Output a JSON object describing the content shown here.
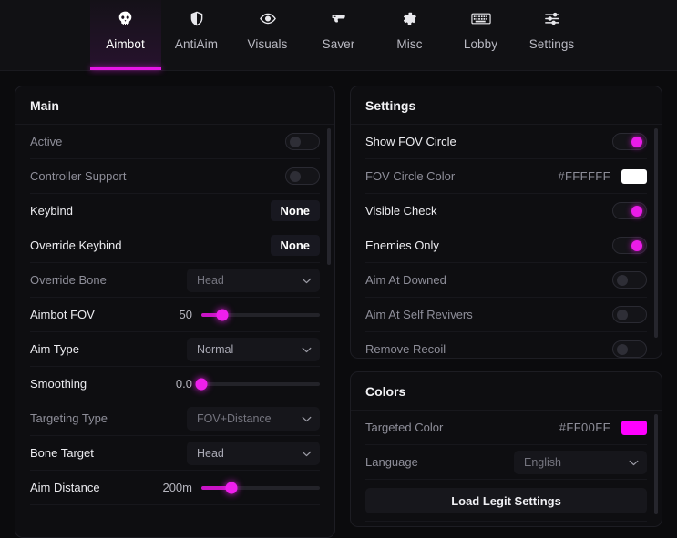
{
  "nav": {
    "tabs": [
      {
        "label": "Aimbot",
        "icon": "skull-icon",
        "active": true
      },
      {
        "label": "AntiAim",
        "icon": "shield-icon",
        "active": false
      },
      {
        "label": "Visuals",
        "icon": "eye-icon",
        "active": false
      },
      {
        "label": "Saver",
        "icon": "pistol-icon",
        "active": false
      },
      {
        "label": "Misc",
        "icon": "gear-icon",
        "active": false
      },
      {
        "label": "Lobby",
        "icon": "keyboard-icon",
        "active": false
      },
      {
        "label": "Settings",
        "icon": "sliders-icon",
        "active": false
      }
    ]
  },
  "accent": "#ee1fec",
  "main_panel": {
    "title": "Main",
    "rows": [
      {
        "label": "Active",
        "type": "toggle",
        "value": "off",
        "dim": true
      },
      {
        "label": "Controller Support",
        "type": "toggle",
        "value": "off",
        "dim": true
      },
      {
        "label": "Keybind",
        "type": "keybind",
        "value": "None",
        "dim": false
      },
      {
        "label": "Override Keybind",
        "type": "keybind",
        "value": "None",
        "dim": false
      },
      {
        "label": "Override Bone",
        "type": "dropdown",
        "value": "Head",
        "dim": true
      },
      {
        "label": "Aimbot FOV",
        "type": "slider",
        "value": "50",
        "percent": 18,
        "dim": false
      },
      {
        "label": "Aim Type",
        "type": "dropdown",
        "value": "Normal",
        "dim": false
      },
      {
        "label": "Smoothing",
        "type": "slider",
        "value": "0.0",
        "percent": 0,
        "dim": false
      },
      {
        "label": "Targeting Type",
        "type": "dropdown",
        "value": "FOV+Distance",
        "dim": true
      },
      {
        "label": "Bone Target",
        "type": "dropdown",
        "value": "Head",
        "dim": false
      },
      {
        "label": "Aim Distance",
        "type": "slider",
        "value": "200m",
        "percent": 25,
        "dim": false
      }
    ]
  },
  "settings_panel": {
    "title": "Settings",
    "rows": [
      {
        "label": "Show FOV Circle",
        "type": "toggle",
        "value": "on",
        "dim": false
      },
      {
        "label": "FOV Circle Color",
        "type": "color",
        "value": "#FFFFFF",
        "swatch": "#ffffff",
        "dim": true
      },
      {
        "label": "Visible Check",
        "type": "toggle",
        "value": "on",
        "dim": false
      },
      {
        "label": "Enemies Only",
        "type": "toggle",
        "value": "on",
        "dim": false
      },
      {
        "label": "Aim At Downed",
        "type": "toggle",
        "value": "off",
        "dim": true
      },
      {
        "label": "Aim At Self Revivers",
        "type": "toggle",
        "value": "off",
        "dim": true
      },
      {
        "label": "Remove Recoil",
        "type": "toggle",
        "value": "off",
        "dim": true
      }
    ]
  },
  "colors_panel": {
    "title": "Colors",
    "rows": [
      {
        "label": "Targeted Color",
        "type": "color",
        "value": "#FF00FF",
        "swatch": "#ff00ff",
        "dim": true
      },
      {
        "label": "Language",
        "type": "dropdown",
        "value": "English",
        "dim": true
      }
    ],
    "button": "Load Legit Settings"
  }
}
